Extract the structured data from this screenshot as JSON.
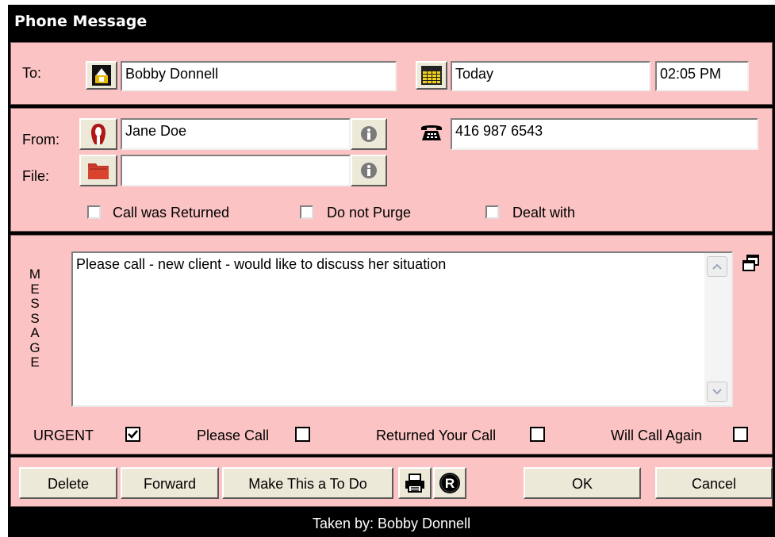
{
  "window": {
    "title": "Phone Message"
  },
  "to": {
    "label": "To:",
    "value": "Bobby Donnell",
    "date": "Today",
    "time": "02:05 PM"
  },
  "from": {
    "label": "From:",
    "value": "Jane Doe",
    "phone": "416 987 6543"
  },
  "file": {
    "label": "File:",
    "value": ""
  },
  "status_checks": [
    {
      "label": "Call was Returned",
      "checked": false
    },
    {
      "label": "Do not Purge",
      "checked": false
    },
    {
      "label": "Dealt with",
      "checked": false
    }
  ],
  "message": {
    "side_label": [
      "M",
      "E",
      "S",
      "S",
      "A",
      "G",
      "E"
    ],
    "text": "Please call - new client - would like to discuss her situation"
  },
  "flags": [
    {
      "label": "URGENT",
      "checked": true
    },
    {
      "label": "Please Call",
      "checked": false
    },
    {
      "label": "Returned Your Call",
      "checked": false
    },
    {
      "label": "Will Call Again",
      "checked": false
    }
  ],
  "buttons": {
    "delete": "Delete",
    "forward": "Forward",
    "todo": "Make This a To Do",
    "ok": "OK",
    "cancel": "Cancel"
  },
  "footer": {
    "taken_by": "Taken by: Bobby Donnell"
  },
  "colors": {
    "panel": "#fbc3c3",
    "frame": "#000000",
    "button": "#ece9d8"
  },
  "icons": {
    "to": "contact-card-icon",
    "calendar": "calendar-icon",
    "from": "person-icon",
    "phone": "telephone-icon",
    "file": "folder-icon",
    "info": "info-icon",
    "expand": "restore-window-icon",
    "print": "printer-icon",
    "record": "r-badge-icon"
  }
}
